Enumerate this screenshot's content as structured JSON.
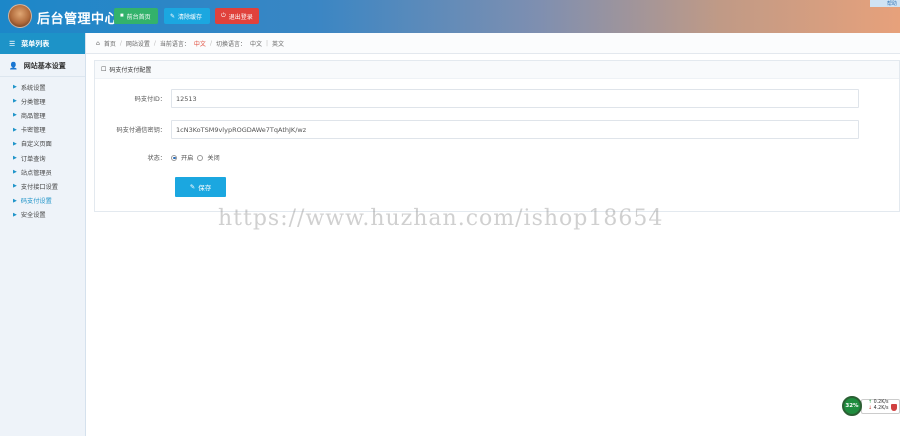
{
  "header": {
    "title": "后台管理中心",
    "buttons": [
      {
        "label": "前台首页",
        "color": "#33b26b"
      },
      {
        "label": "清除缓存",
        "color": "#1ba7e0"
      },
      {
        "label": "退出登录",
        "color": "#e0413b"
      }
    ],
    "corner_badge": "帮助"
  },
  "sidebar": {
    "menu_title": "菜单列表",
    "section_title": "网站基本设置",
    "items": [
      {
        "label": "系统设置"
      },
      {
        "label": "分类管理"
      },
      {
        "label": "商品管理"
      },
      {
        "label": "卡密管理"
      },
      {
        "label": "自定义页面"
      },
      {
        "label": "订单查询"
      },
      {
        "label": "站点管理员"
      },
      {
        "label": "支付接口设置"
      },
      {
        "label": "码支付设置"
      },
      {
        "label": "安全设置"
      }
    ],
    "active_index": 8
  },
  "breadcrumb": {
    "home": "首页",
    "items": [
      "网站设置"
    ],
    "language_label": "当前语言：",
    "language_value": "中文",
    "switch_label": "切换语言：",
    "switch_options": [
      "中文",
      "英文"
    ]
  },
  "panel": {
    "title": "码支付支付配置",
    "fields": [
      {
        "label": "码支付ID：",
        "value": "12513"
      },
      {
        "label": "码支付通信密钥：",
        "value": "1cN3KoTSM9vlypROGDAWe7TqAthJK/wz"
      }
    ],
    "status_label": "状态：",
    "status_options": [
      "开启",
      "关闭"
    ],
    "status_selected": "开启",
    "save_label": "保存"
  },
  "watermark": "https://www.huzhan.com/ishop18654",
  "net_widget": {
    "percent": "32%",
    "up": "0.2K/s",
    "down": "4.2K/s"
  }
}
